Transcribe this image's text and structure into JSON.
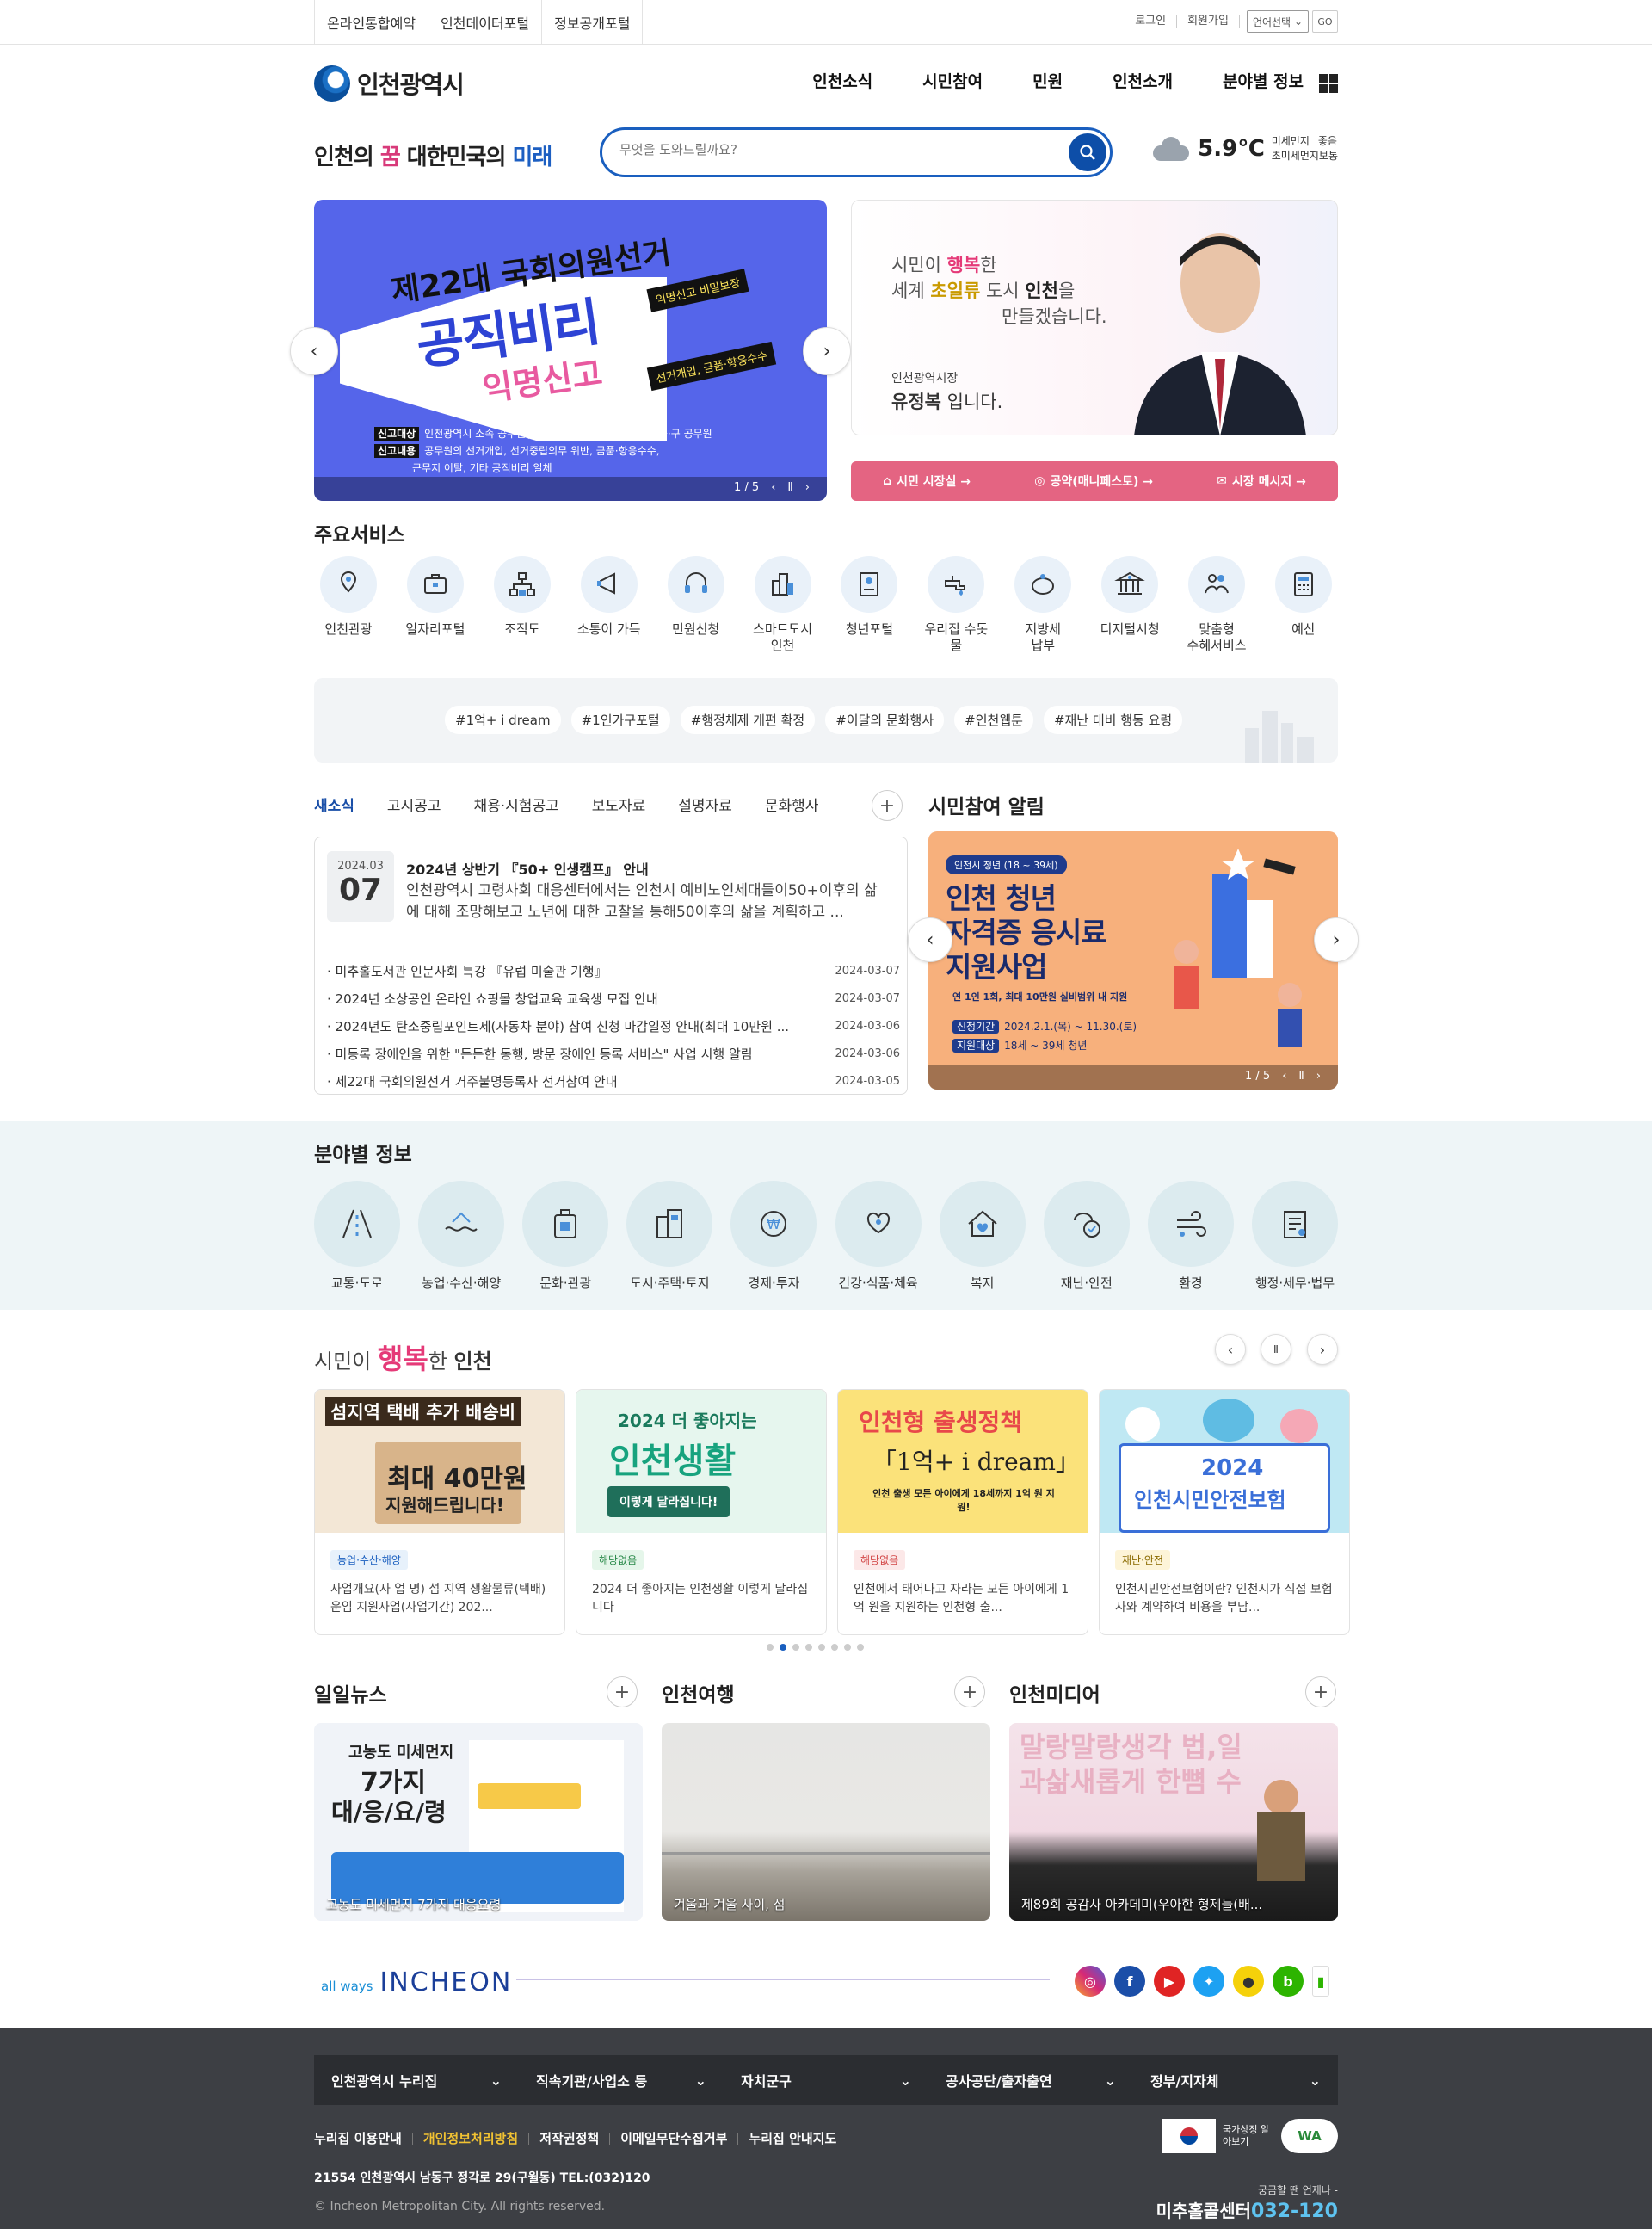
{
  "util": {
    "links": [
      "온라인통합예약",
      "인천데이터포털",
      "정보공개포털"
    ],
    "login": "로그인",
    "join": "회원가입",
    "lang": "언어선택",
    "go": "GO"
  },
  "header": {
    "logo": "인천광역시",
    "menu": [
      "인천소식",
      "시민참여",
      "민원",
      "인천소개",
      "분야별 정보"
    ]
  },
  "slogan": {
    "a": "인천의 ",
    "b": "꿈",
    "c": " 대한민국의 ",
    "d": "미래"
  },
  "search": {
    "placeholder": "무엇을 도와드릴까요?"
  },
  "weather": {
    "temp": "5.9℃",
    "pm10_label": "미세먼지",
    "pm10": "좋음",
    "pm25_label": "초미세먼지",
    "pm25": "보통"
  },
  "banner": {
    "title1": "제22대 국회의원선거",
    "title2": "공직비리",
    "title3": "익명신고",
    "tag1": "익명신고 비밀보장",
    "tag2": "선거개입, 금품·향응수수",
    "info1_k": "신고대상",
    "info1": "인천광역시 소속 공무원(사업소, 직속기관 등 포함) 및 군·구 공무원",
    "info2_k": "신고내용",
    "info2": "공무원의 선거개입, 선거중립의무 위반, 금품·향응수수,",
    "info3": "근무지 이탈, 기타 공직비리 일체",
    "pager": "1 / 5"
  },
  "mayor": {
    "l1a": "시민이 ",
    "l1b": "행복",
    "l1c": "한",
    "l2a": "세계 ",
    "l2b": "초일류",
    "l2c": " 도시 ",
    "l2d": "인천",
    "l2e": "을",
    "l3": "만들겠습니다.",
    "role": "인천광역시장",
    "name": "유정복",
    "name_suffix": " 입니다."
  },
  "mayor_links": [
    "시민 시장실 →",
    "공약(매니페스토) →",
    "시장 메시지 →"
  ],
  "services": {
    "title": "주요서비스",
    "items": [
      "인천관광",
      "일자리포털",
      "조직도",
      "소통이 가득",
      "민원신청",
      "스마트도시\n인천",
      "청년포털",
      "우리집 수돗물",
      "지방세\n납부",
      "디지털시청",
      "맞춤형\n수혜서비스",
      "예산"
    ]
  },
  "hashtags": [
    "#1억+ i dream",
    "#1인가구포털",
    "#행정체제 개편 확정",
    "#이달의 문화행사",
    "#인천웹툰",
    "#재난 대비 행동 요령"
  ],
  "news": {
    "tabs": [
      "새소식",
      "고시공고",
      "채용·시험공고",
      "보도자료",
      "설명자료",
      "문화행사"
    ],
    "featured": {
      "ym": "2024.03",
      "dd": "07",
      "title": "2024년 상반기 『50+ 인생캠프』 안내",
      "desc": "인천광역시 고령사회 대응센터에서는 인천시 예비노인세대들이50+이후의 삶에 대해 조망해보고 노년에 대한 고찰을 통해50이후의 삶을 계획하고 ..."
    },
    "list": [
      {
        "t": "미추홀도서관 인문사회 특강 『유럽 미술관 기행』",
        "d": "2024-03-07"
      },
      {
        "t": "2024년 소상공인 온라인 쇼핑몰 창업교육 교육생 모집 안내",
        "d": "2024-03-07"
      },
      {
        "t": "2024년도 탄소중립포인트제(자동차 분야) 참여 신청 마감일정 안내(최대 10만원 ...",
        "d": "2024-03-06"
      },
      {
        "t": "미등록 장애인을 위한 \"든든한 동행, 방문 장애인 등록 서비스\" 사업 시행 알림",
        "d": "2024-03-06"
      },
      {
        "t": "제22대 국회의원선거 거주불명등록자 선거참여 안내",
        "d": "2024-03-05"
      }
    ]
  },
  "participation": {
    "title": "시민참여 알림",
    "head": "인천시 청년 (18 ~ 39세)",
    "t1": "인천 청년",
    "t2": "자격증 응시료",
    "t3": "지원사업",
    "sub": "연 1인 1회, 최대 10만원 실비범위 내 지원",
    "k1": "신청기간",
    "v1": "2024.2.1.(목) ~ 11.30.(토)",
    "k2": "지원대상",
    "v2": "18세 ~ 39세 청년",
    "pager": "1 / 5"
  },
  "fields": {
    "title": "분야별 정보",
    "items": [
      "교통·도로",
      "농업·수산·해양",
      "문화·관광",
      "도시·주택·토지",
      "경제·투자",
      "건강·식품·체육",
      "복지",
      "재난·안전",
      "환경",
      "행정·세무·법무"
    ]
  },
  "happy": {
    "a": "시민이 ",
    "b": "행복",
    "c": "한 ",
    "d": "인천",
    "cards": [
      {
        "img1": "섬지역 택배 추가 배송비",
        "img2": "최대 40만원",
        "img3": "지원해드립니다!",
        "badge": "농업·수산·해양",
        "text": "사업개요(사 업 명) 섬 지역 생활물류(택배) 운임 지원사업(사업기간) 202..."
      },
      {
        "img1": "2024 더 좋아지는",
        "img2": "인천생활",
        "img3": "이렇게 달라집니다!",
        "badge": "해당없음",
        "text": "2024 더 좋아지는 인천생활 이렇게 달라집니다"
      },
      {
        "img1": "인천형 출생정책",
        "img2": "「1억+ i dream」",
        "img3": "인천 출생 모든 아이에게 18세까지 1억 원 지원!",
        "badge": "해당없음",
        "text": "인천에서 태어나고 자라는 모든 아이에게 1억 원을 지원하는 인천형 출..."
      },
      {
        "img1": "2024",
        "img2": "인천시민안전보험",
        "img3": "",
        "badge": "재난·안전",
        "text": "인천시민안전보험이란? 인천시가 직접 보험사와 계약하여 비용을 부담..."
      }
    ]
  },
  "media": {
    "daily": {
      "title": "일일뉴스",
      "img1": "고농도 미세먼지",
      "img2": "7가지",
      "img3": "대/응/요/령",
      "caption": "고농도 미세먼지 7가지 대응요령"
    },
    "travel": {
      "title": "인천여행",
      "caption": "겨울과 겨울 사이, 섬"
    },
    "tv": {
      "title": "인천미디어",
      "img": "말랑말랑생각 법,일과삶새롭게 한뼘 수",
      "caption": "제89회 공감사 아카데미(우아한 형제들(배..."
    }
  },
  "sns": {
    "small": "all ways",
    "brand": "INCHEON"
  },
  "footer": {
    "selects": [
      "인천광역시 누리집",
      "직속기관/사업소 등",
      "자치군구",
      "공사공단/출자출연",
      "정부/지자체"
    ],
    "links": [
      "누리집 이용안내",
      "개인정보처리방침",
      "저작권정책",
      "이메일무단수집거부",
      "누리집 안내지도"
    ],
    "address": "21554 인천광역시 남동구 정각로 29(구월동) TEL:(032)120",
    "copyright": "© Incheon Metropolitan City. All rights reserved.",
    "mark": "국가상징 알아보기",
    "call_small": "궁금할 땐 언제나 -",
    "call_name": "미추홀콜센터",
    "call_num": "032-120"
  },
  "colors": {
    "primary": "#1a5fbf",
    "pink": "#e46482",
    "footer": "#3d3f44"
  }
}
